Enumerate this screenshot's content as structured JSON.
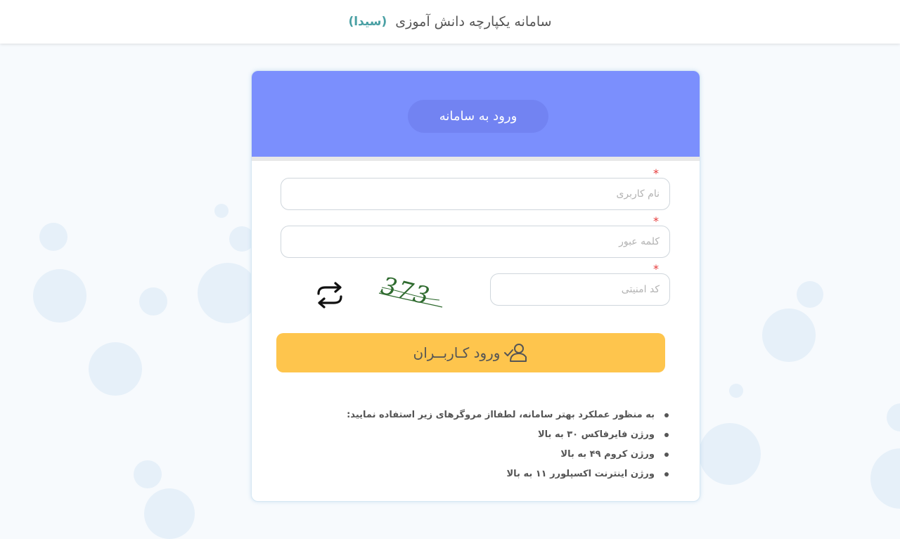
{
  "header": {
    "title": "سامانه یکپارچه دانش آموزی",
    "brand": "(سیدا)"
  },
  "login": {
    "heading": "ورود به سامانه",
    "username": {
      "placeholder": "نام کاربری",
      "value": ""
    },
    "password": {
      "placeholder": "کلمه عبور",
      "value": ""
    },
    "captcha_field": {
      "placeholder": "کد امنیتی",
      "value": ""
    },
    "captcha_image_text": "373",
    "required_mark": "*",
    "submit_label": "ورود کـاربــران"
  },
  "notes": [
    "به منظور عملکرد بهتر سامانه، لطفااز مروگرهای زیر استفاده نمایید:",
    "ورژن فایرفاکس ۳۰ به بالا",
    "ورژن کروم ۴۹ به بالا",
    "ورژن اینترنت اکسپلورر ۱۱ به بالا"
  ],
  "colors": {
    "header_accent": "#7b8ffd",
    "button": "#fec54d",
    "brand": "#4aa0a4",
    "required": "#e63c3c"
  },
  "icons": {
    "refresh": "refresh-icon",
    "user_check": "user-check-icon"
  }
}
